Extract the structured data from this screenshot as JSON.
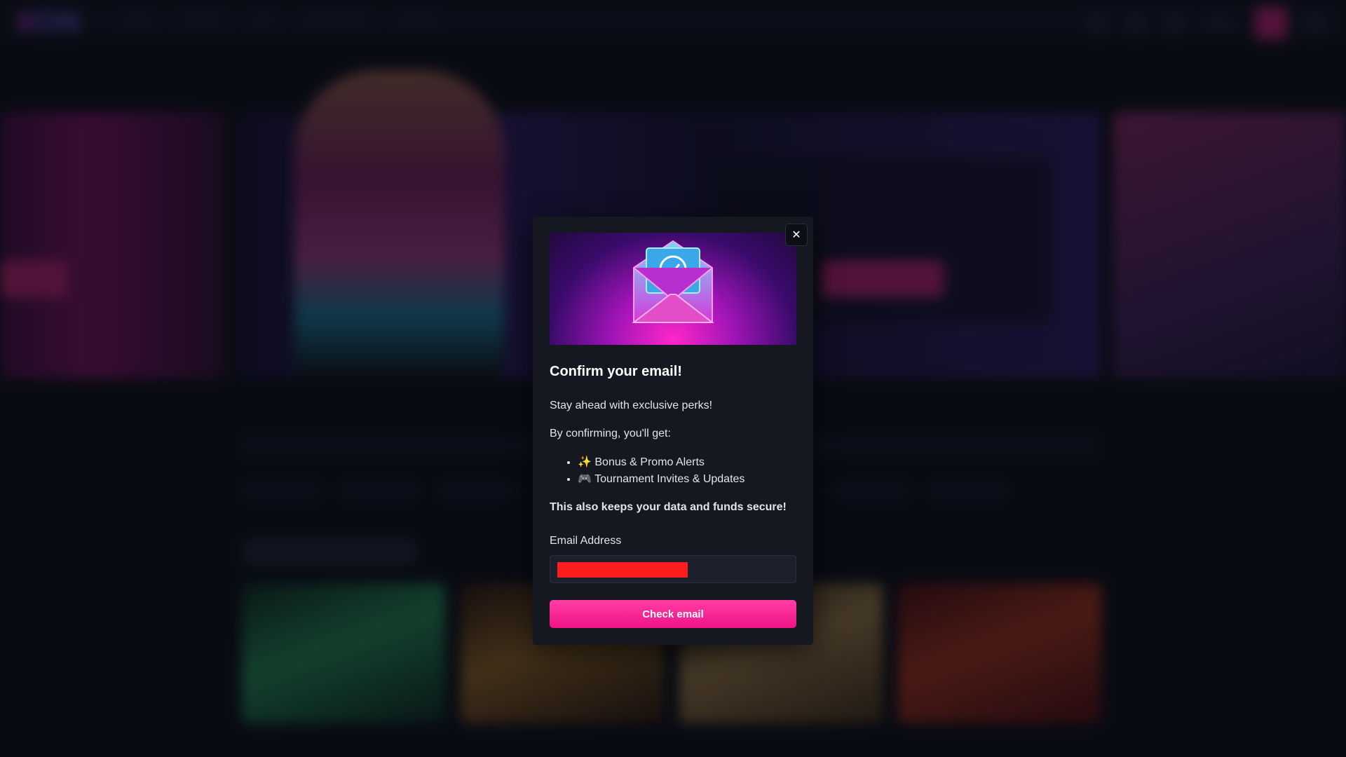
{
  "background": {
    "logo_text": "X",
    "logo_text2": "ON"
  },
  "modal": {
    "title": "Confirm your email!",
    "intro": "Stay ahead with exclusive perks!",
    "lead": "By confirming, you'll get:",
    "perks": [
      "✨ Bonus & Promo Alerts",
      "🎮 Tournament Invites & Updates"
    ],
    "secure_note": "This also keeps your data and funds secure!",
    "email_label": "Email Address",
    "email_value": "",
    "button_label": "Check email",
    "close_icon": "close-icon",
    "banner_icon": "envelope-check-icon"
  },
  "colors": {
    "accent": "#f01287",
    "modal_bg": "#161821",
    "page_bg": "#0c0e17"
  }
}
